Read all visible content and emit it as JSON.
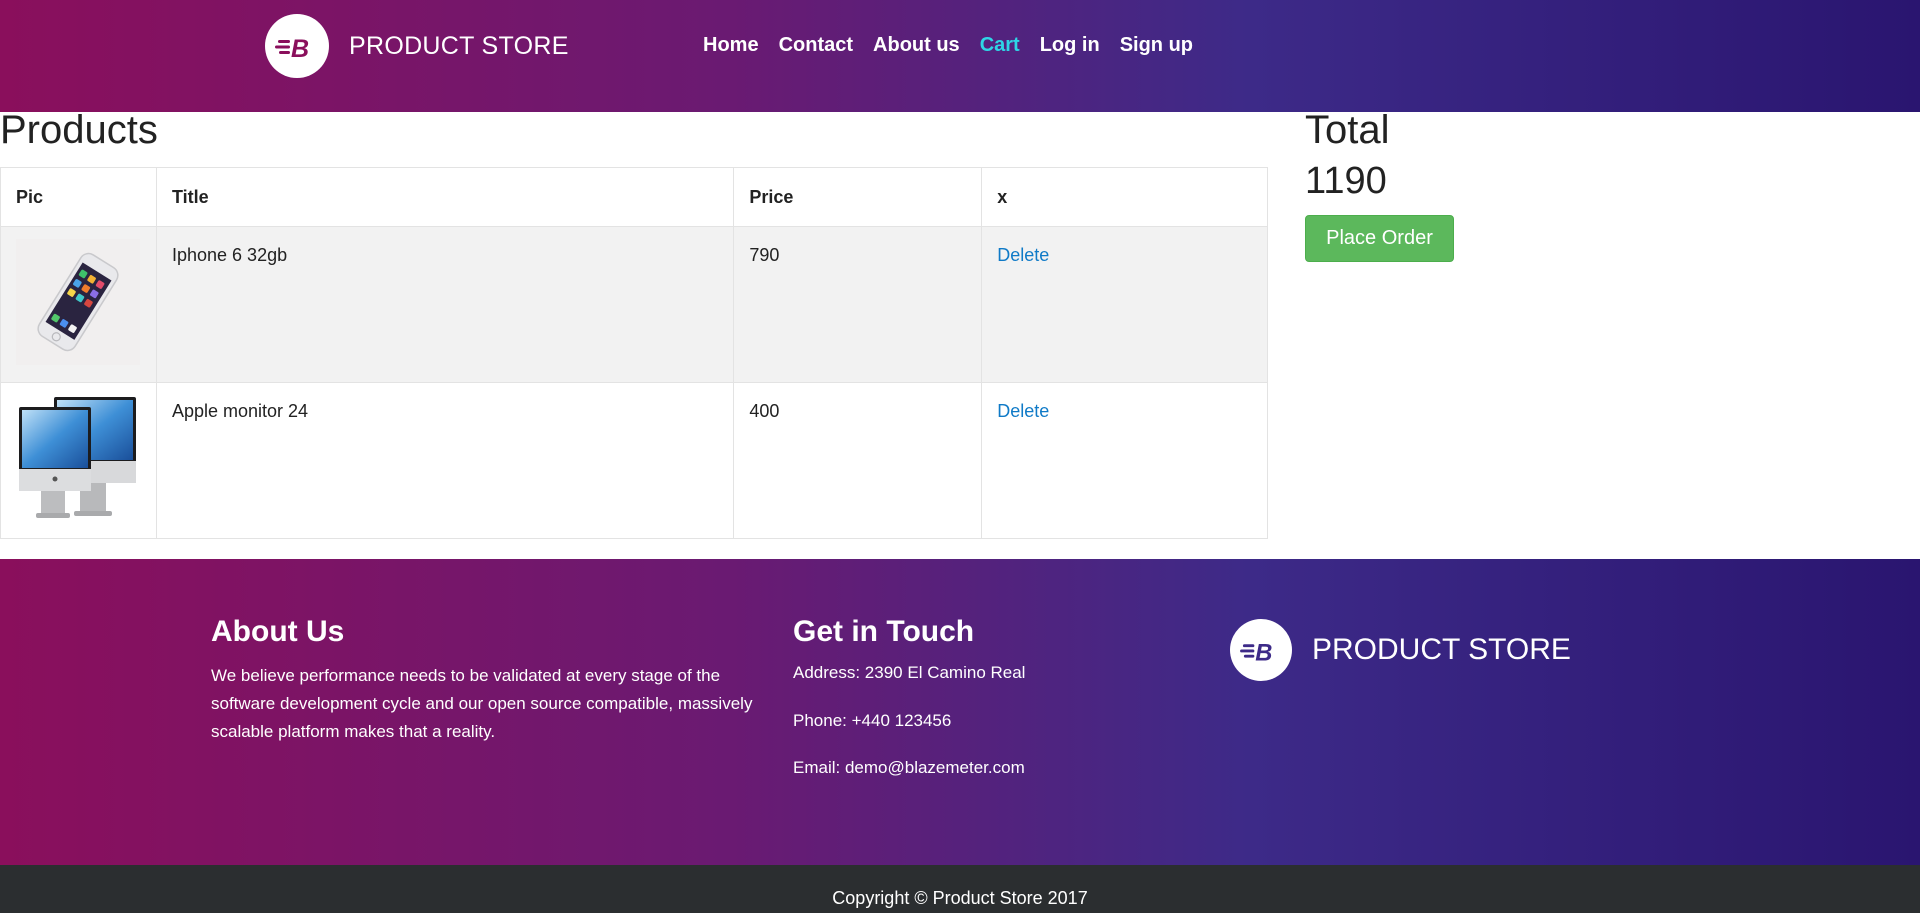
{
  "header": {
    "brand": "PRODUCT STORE",
    "nav": [
      {
        "label": "Home",
        "active": false
      },
      {
        "label": "Contact",
        "active": false
      },
      {
        "label": "About us",
        "active": false
      },
      {
        "label": "Cart",
        "active": true
      },
      {
        "label": "Log in",
        "active": false
      },
      {
        "label": "Sign up",
        "active": false
      }
    ]
  },
  "products": {
    "title": "Products",
    "columns": [
      "Pic",
      "Title",
      "Price",
      "x"
    ],
    "rows": [
      {
        "image": "iphone-image",
        "title": "Iphone 6 32gb",
        "price": "790",
        "action": "Delete"
      },
      {
        "image": "monitor-image",
        "title": "Apple monitor 24",
        "price": "400",
        "action": "Delete"
      }
    ]
  },
  "total": {
    "label": "Total",
    "value": "1190",
    "place_order": "Place Order"
  },
  "footer": {
    "about_title": "About Us",
    "about_text": "We believe performance needs to be validated at every stage of the software development cycle and our open source compatible, massively scalable platform makes that a reality.",
    "touch_title": "Get in Touch",
    "address": "Address: 2390 El Camino Real",
    "phone": "Phone: +440 123456",
    "email": "Email: demo@blazemeter.com",
    "brand": "PRODUCT STORE",
    "copyright": "Copyright © Product Store 2017"
  },
  "colors": {
    "gradient_start": "#8a0f5c",
    "gradient_end": "#2a1570",
    "active_nav": "#2ed6e6",
    "link": "#0f7ac7",
    "button": "#5cb85c"
  }
}
